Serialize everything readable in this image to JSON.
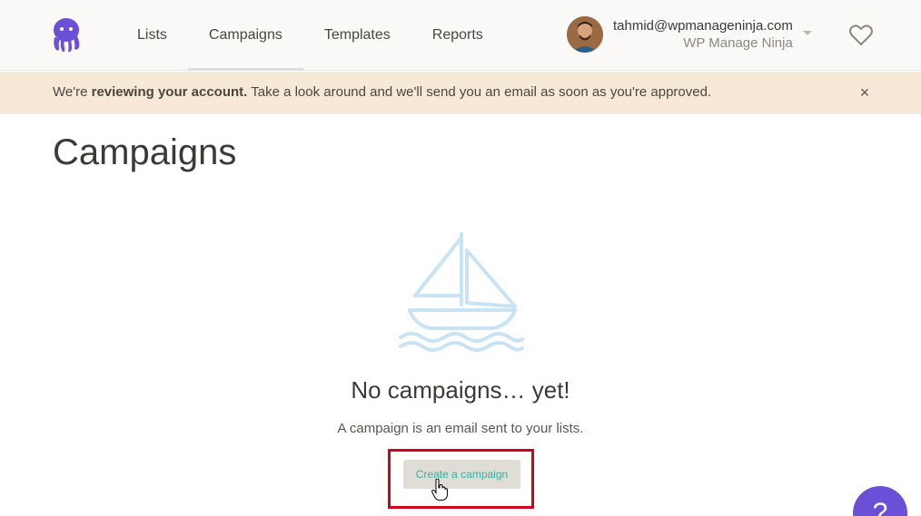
{
  "nav": {
    "items": [
      {
        "label": "Lists",
        "active": false
      },
      {
        "label": "Campaigns",
        "active": true
      },
      {
        "label": "Templates",
        "active": false
      },
      {
        "label": "Reports",
        "active": false
      }
    ]
  },
  "user": {
    "email": "tahmid@wpmanageninja.com",
    "organization": "WP Manage Ninja"
  },
  "banner": {
    "prefix": "We're ",
    "bold": "reviewing your account.",
    "suffix": " Take a look around and we'll send you an email as soon as you're approved.",
    "close_icon": "×"
  },
  "page": {
    "title": "Campaigns"
  },
  "empty_state": {
    "title": "No campaigns… yet!",
    "subtitle": "A campaign is an email sent to your lists.",
    "button_label": "Create a campaign"
  },
  "help": {
    "label": "?"
  },
  "colors": {
    "brand": "#6b4fd6",
    "banner_bg": "#f7e9d7",
    "button_text": "#2bb5a0",
    "highlight": "#d0021b",
    "boat": "#c8e4f4"
  },
  "icons": {
    "logo": "octopus-logo-icon",
    "heart": "heart-icon",
    "close": "close-icon",
    "boat": "sailboat-icon",
    "cursor": "hand-cursor-icon"
  }
}
